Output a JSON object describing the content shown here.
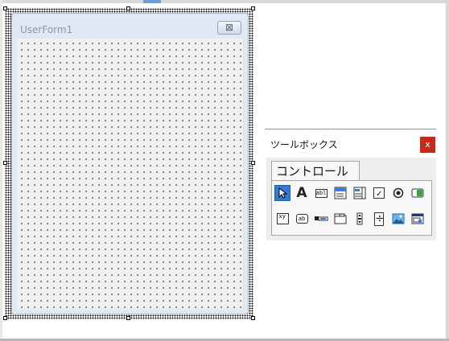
{
  "userform": {
    "title": "UserForm1",
    "close_glyph": "⊠"
  },
  "toolbox": {
    "title": "ツールボックス",
    "close_glyph": "x",
    "tab_label": "コントロール",
    "tools_row1": [
      {
        "name": "select-objects-icon"
      },
      {
        "name": "label-icon",
        "glyph": "A"
      },
      {
        "name": "textbox-icon",
        "glyph": "abl"
      },
      {
        "name": "combobox-icon"
      },
      {
        "name": "listbox-icon"
      },
      {
        "name": "checkbox-icon",
        "glyph": "✓"
      },
      {
        "name": "optionbutton-icon",
        "glyph": "⊙"
      },
      {
        "name": "togglebutton-icon"
      }
    ],
    "tools_row2": [
      {
        "name": "frame-icon",
        "glyph": "xy"
      },
      {
        "name": "commandbutton-icon",
        "glyph": "ab"
      },
      {
        "name": "tabstrip-icon"
      },
      {
        "name": "multipage-icon"
      },
      {
        "name": "scrollbar-icon"
      },
      {
        "name": "spinbutton-icon",
        "glyph": "÷"
      },
      {
        "name": "image-icon"
      },
      {
        "name": "refedit-icon"
      }
    ]
  }
}
